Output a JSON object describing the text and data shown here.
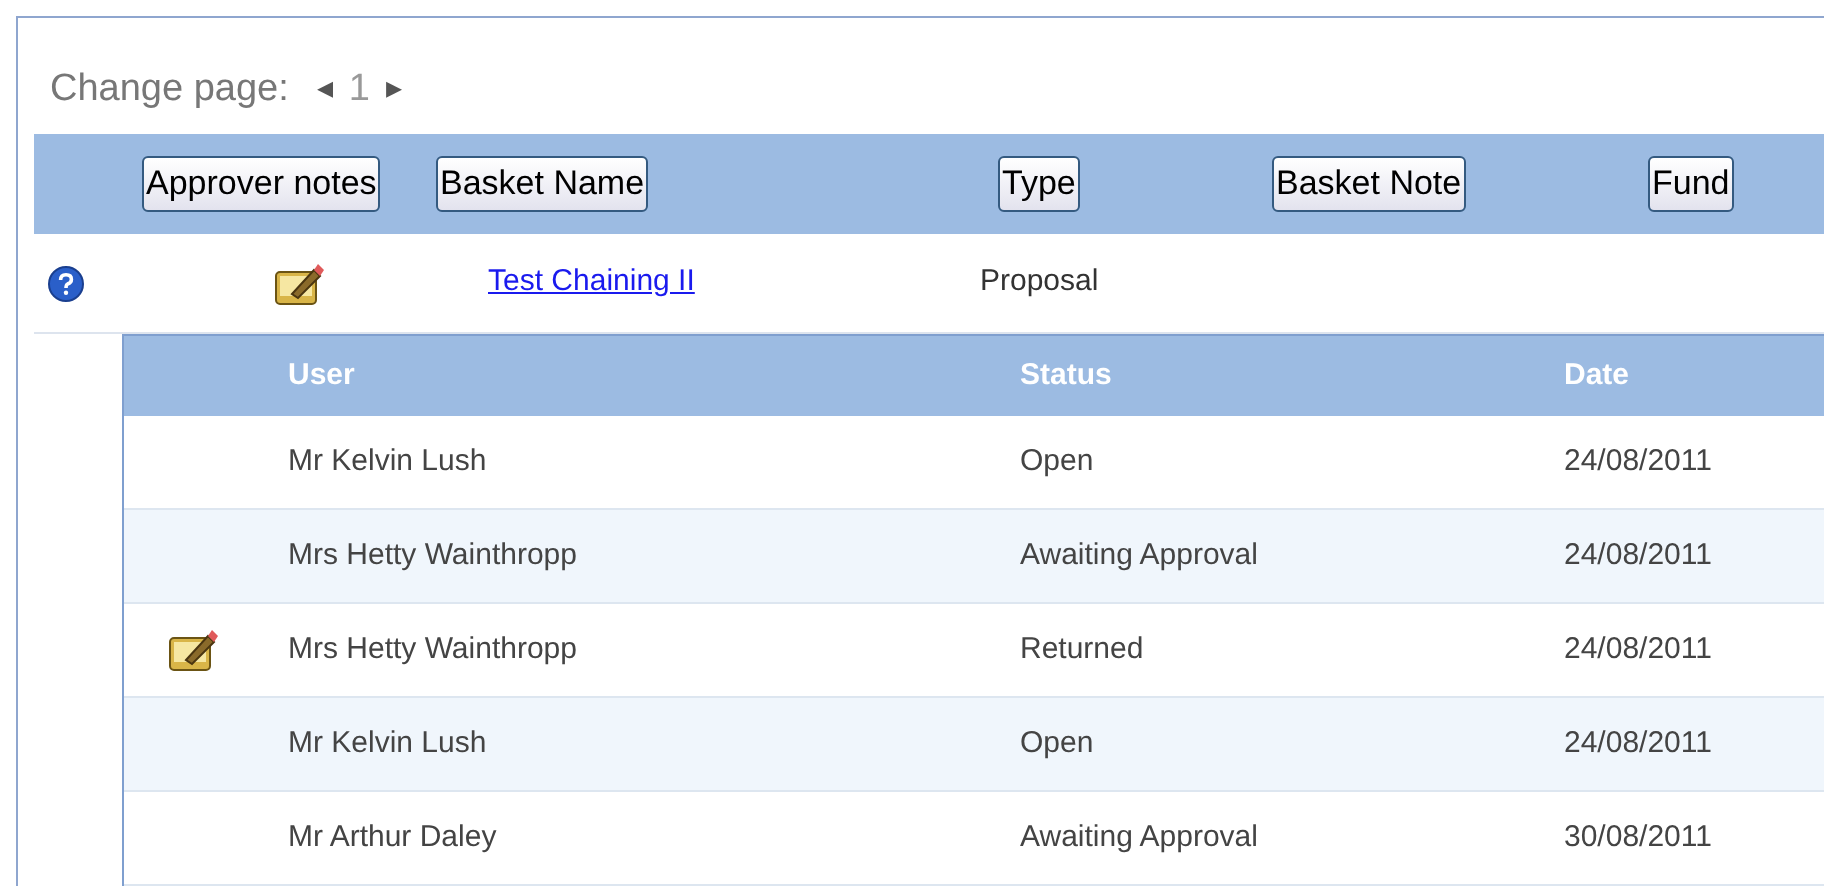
{
  "pager": {
    "label": "Change page:",
    "prev": "◂",
    "page": "1",
    "next": "▸"
  },
  "columns": [
    "Approver notes",
    "Basket Name",
    "Type",
    "Basket Note",
    "Fund"
  ],
  "basket": {
    "has_note": true,
    "name": "Test Chaining II",
    "type": "Proposal"
  },
  "history": {
    "columns": [
      "User",
      "Status",
      "Date"
    ],
    "rows": [
      {
        "has_note": false,
        "user": "Mr Kelvin Lush",
        "status": "Open",
        "date": "24/08/2011"
      },
      {
        "has_note": false,
        "user": "Mrs Hetty Wainthropp",
        "status": "Awaiting Approval",
        "date": "24/08/2011"
      },
      {
        "has_note": true,
        "user": "Mrs Hetty Wainthropp",
        "status": "Returned",
        "date": "24/08/2011"
      },
      {
        "has_note": false,
        "user": "Mr Kelvin Lush",
        "status": "Open",
        "date": "24/08/2011"
      },
      {
        "has_note": false,
        "user": "Mr Arthur Daley",
        "status": "Awaiting Approval",
        "date": "30/08/2011"
      }
    ]
  }
}
